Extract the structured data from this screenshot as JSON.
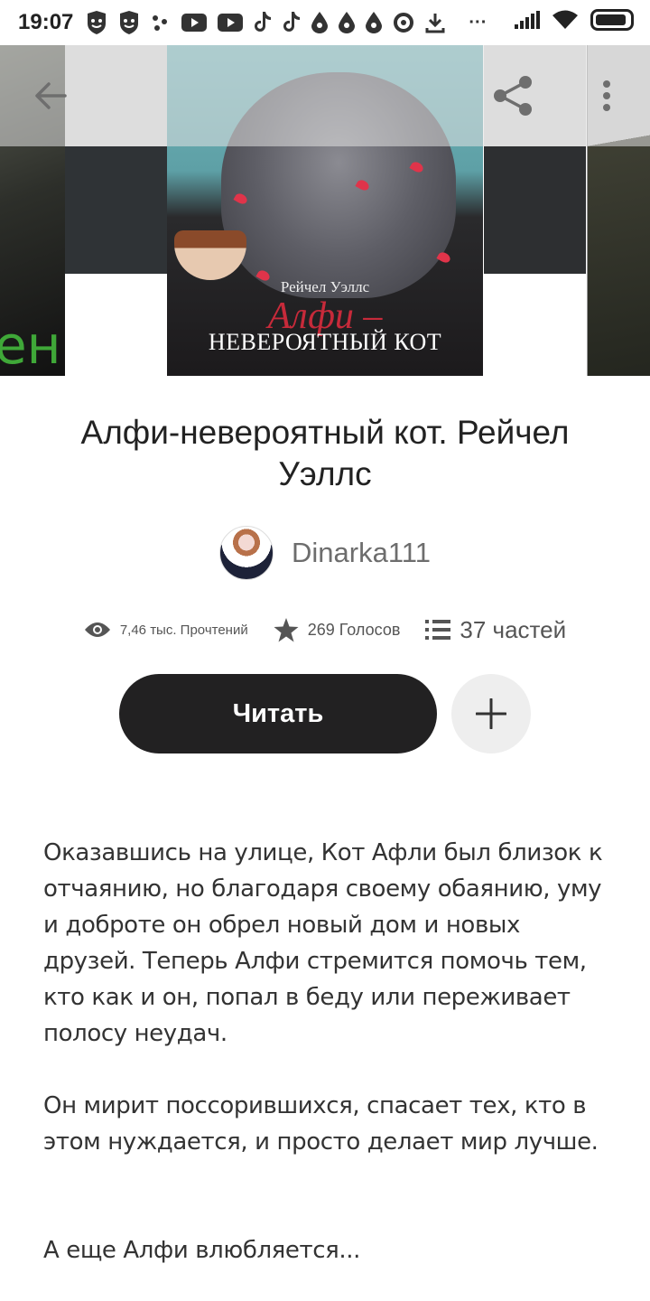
{
  "status_bar": {
    "time": "19:07",
    "icons": [
      "shield-app-icon",
      "shield-app-icon",
      "dots-app-icon",
      "youtube-icon",
      "youtube-icon",
      "tiktok-icon",
      "tiktok-icon",
      "drop-icon",
      "drop-icon",
      "drop-icon",
      "sync-icon",
      "download-icon"
    ],
    "more": "···"
  },
  "toolbar": {
    "back_icon": "arrow-left-icon",
    "share_icon": "share-icon",
    "more_icon": "more-vertical-icon"
  },
  "cover": {
    "author": "Рейчел Уэллс",
    "script_title": "Алфи –",
    "title": "НЕВЕРОЯТНЫЙ КОТ",
    "left_fragment": "ен"
  },
  "book": {
    "title": "Алфи-невероятный кот. Рейчел Уэллс",
    "author": "Dinarka111"
  },
  "stats": {
    "reads": "7,46 тыс. Прочтений",
    "votes": "269 Голосов",
    "parts": "37 частей"
  },
  "actions": {
    "read_label": "Читать",
    "add_icon": "plus-icon"
  },
  "description": {
    "paragraphs": [
      "Оказавшись на улице, Кот Афли был близок к отчаянию, но благодаря своему обаянию, уму и доброте он обрел новый дом и новых друзей. Теперь Алфи стремится помочь тем, кто как и он, попал в беду или переживает полосу неудач.",
      "Он мирит поссорившихся, спасает тех, кто в этом нуждается, и просто делает мир лучше.",
      "А еще Алфи влюбляется..."
    ]
  }
}
